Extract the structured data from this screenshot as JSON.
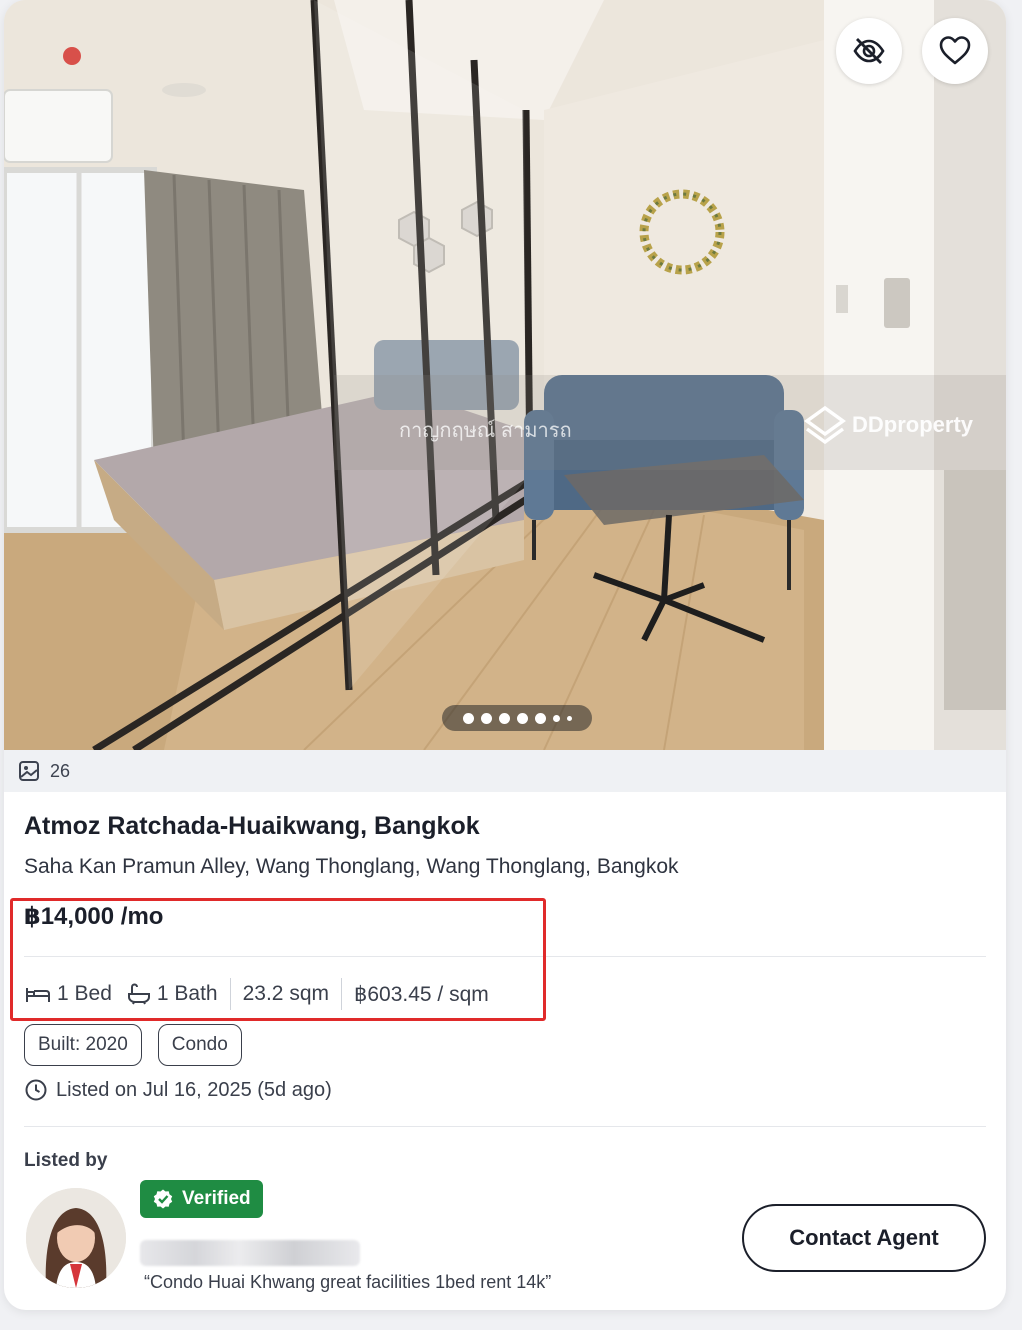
{
  "photo": {
    "watermark_brand": "DDproperty",
    "watermark_name": "กาญกฤษณ์ สามารถ",
    "carousel_total_dots": 7
  },
  "photo_count": "26",
  "listing": {
    "title": "Atmoz Ratchada-Huaikwang, Bangkok",
    "address": "Saha Kan Pramun Alley, Wang Thonglang, Wang Thonglang, Bangkok",
    "price": "฿14,000 /mo",
    "beds": "1 Bed",
    "baths": "1 Bath",
    "area": "23.2 sqm",
    "price_per_sqm": "฿603.45 / sqm",
    "tags": [
      "Built: 2020",
      "Condo"
    ],
    "listed_on": "Listed on Jul 16, 2025 (5d ago)"
  },
  "agent": {
    "listed_by_label": "Listed by",
    "verified_label": "Verified",
    "quote": "“Condo Huai Khwang great facilities 1bed rent 14k”",
    "contact_label": "Contact Agent"
  },
  "colors": {
    "verified_green": "#1f8c43",
    "highlight_red": "#e02a2a",
    "text_dark": "#1b1f2a"
  }
}
